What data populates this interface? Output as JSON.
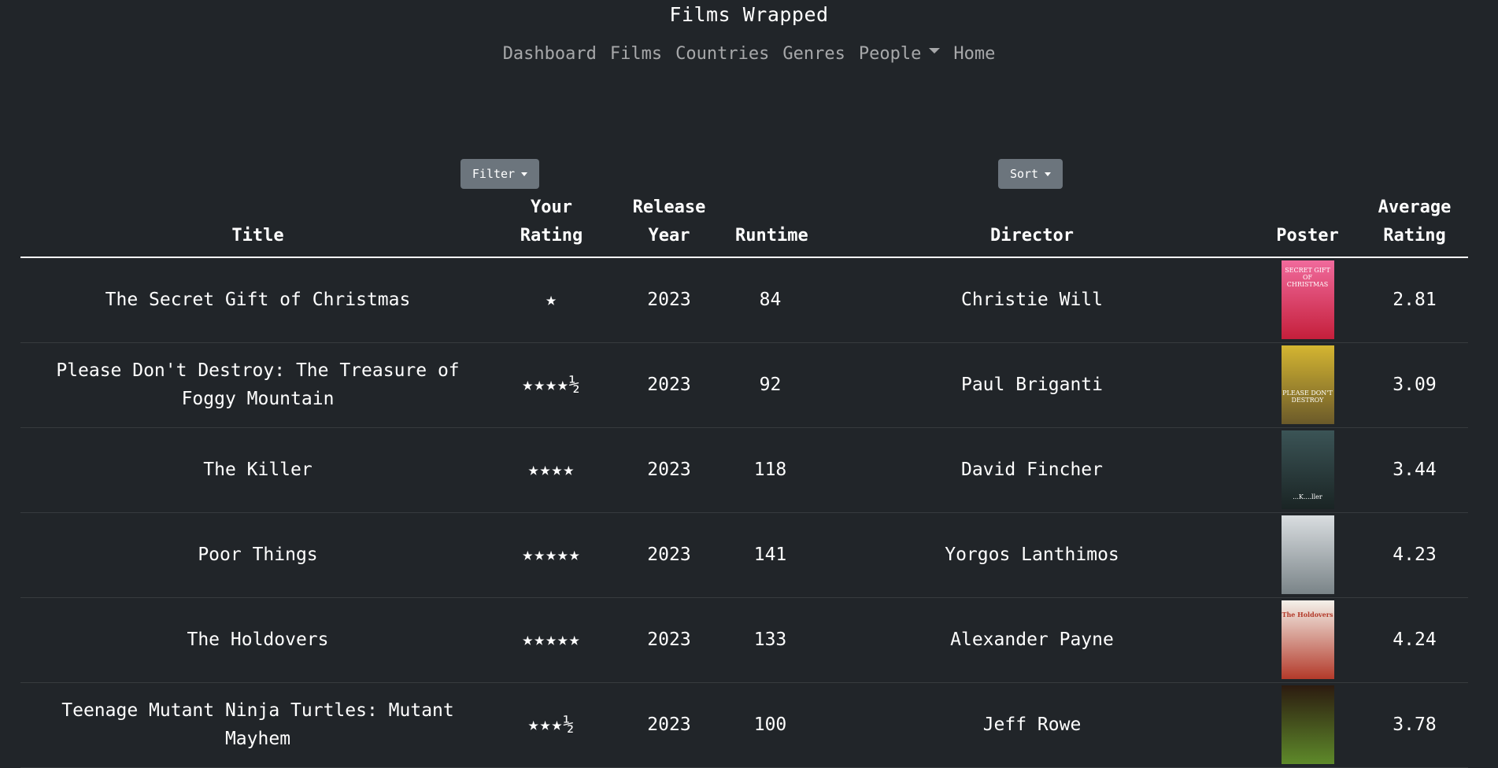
{
  "app": {
    "title": "Films Wrapped"
  },
  "nav": {
    "items": [
      "Dashboard",
      "Films",
      "Countries",
      "Genres",
      "People"
    ],
    "home": "Home"
  },
  "controls": {
    "filter_label": "Filter",
    "sort_label": "Sort"
  },
  "table": {
    "headers": {
      "title": "Title",
      "your_rating": [
        "Your",
        "Rating"
      ],
      "release_year": [
        "Release",
        "Year"
      ],
      "runtime": "Runtime",
      "director": "Director",
      "poster": "Poster",
      "average_rating": [
        "Average",
        "Rating"
      ]
    },
    "rows": [
      {
        "title": "The Secret Gift of Christmas",
        "rating": "★",
        "year": "2023",
        "runtime": "84",
        "director": "Christie Will",
        "avg": "2.81",
        "poster_colors": [
          "#f06a9c",
          "#c51f3b"
        ],
        "poster_text": "SECRET GIFT OF CHRISTMAS"
      },
      {
        "title": "Please Don't Destroy: The Treasure of Foggy Mountain",
        "rating": "★★★★½",
        "year": "2023",
        "runtime": "92",
        "director": "Paul Briganti",
        "avg": "3.09",
        "poster_colors": [
          "#d4b531",
          "#6b5a2a"
        ],
        "poster_text": "PLEASE DON'T DESTROY"
      },
      {
        "title": "The Killer",
        "rating": "★★★★",
        "year": "2023",
        "runtime": "118",
        "director": "David Fincher",
        "avg": "3.44",
        "poster_colors": [
          "#3b5456",
          "#1a2424"
        ],
        "poster_text": "...K....ller"
      },
      {
        "title": "Poor Things",
        "rating": "★★★★★",
        "year": "2023",
        "runtime": "141",
        "director": "Yorgos Lanthimos",
        "avg": "4.23",
        "poster_colors": [
          "#d9dde0",
          "#7a8488"
        ],
        "poster_text": ""
      },
      {
        "title": "The Holdovers",
        "rating": "★★★★★",
        "year": "2023",
        "runtime": "133",
        "director": "Alexander Payne",
        "avg": "4.24",
        "poster_colors": [
          "#f4f1ea",
          "#b33a2a"
        ],
        "poster_text": "The Holdovers"
      },
      {
        "title": "Teenage Mutant Ninja Turtles: Mutant Mayhem",
        "rating": "★★★½",
        "year": "2023",
        "runtime": "100",
        "director": "Jeff Rowe",
        "avg": "3.78",
        "poster_colors": [
          "#2c1b10",
          "#5e8a2a"
        ],
        "poster_text": ""
      }
    ]
  },
  "colors": {
    "background": "#212529",
    "button": "#6c757d",
    "nav_text": "rgba(255,255,255,0.6)",
    "row_border": "#373b3e"
  }
}
